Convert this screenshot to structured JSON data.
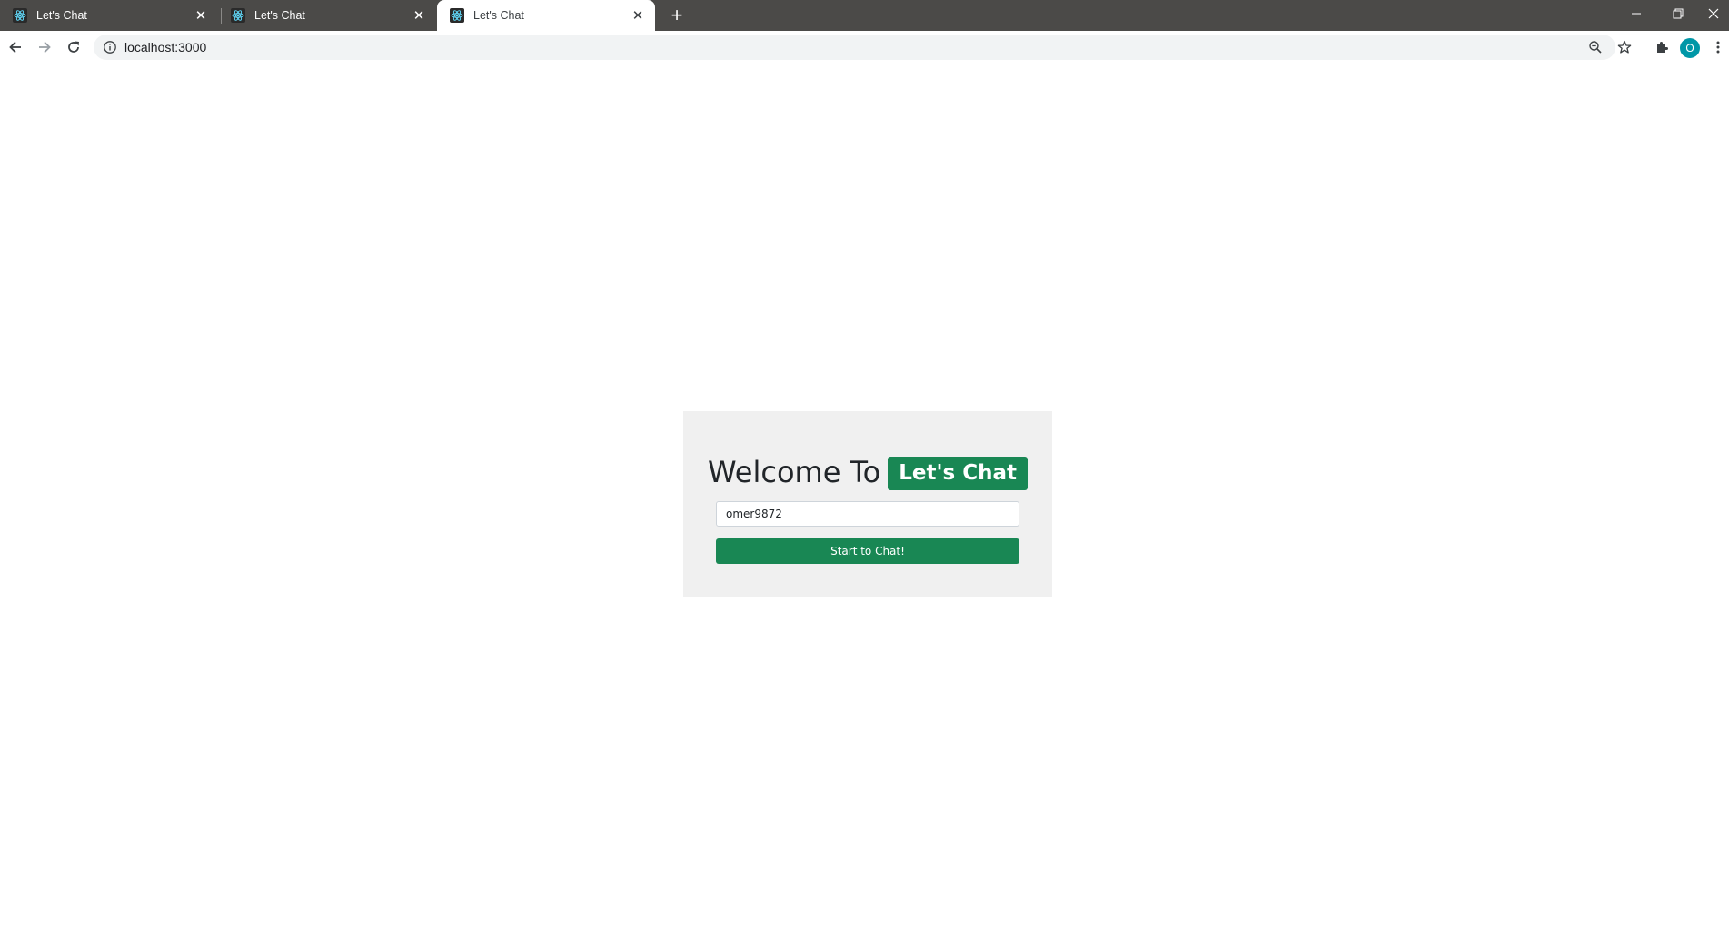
{
  "browser": {
    "tabs": [
      {
        "title": "Let's Chat",
        "active": false
      },
      {
        "title": "Let's Chat",
        "active": false
      },
      {
        "title": "Let's Chat",
        "active": true
      }
    ],
    "new_tab_glyph": "+",
    "close_glyph": "✕",
    "address": "localhost:3000",
    "profile_initial": "O",
    "colors": {
      "tabstrip": "#4b4a48",
      "profile": "#0097a7"
    }
  },
  "page": {
    "welcome_text": "Welcome To",
    "brand": "Let's Chat",
    "username_value": "omer9872",
    "start_button_label": "Start to Chat!",
    "colors": {
      "card_bg": "#f0f0f0",
      "accent": "#198754"
    }
  }
}
